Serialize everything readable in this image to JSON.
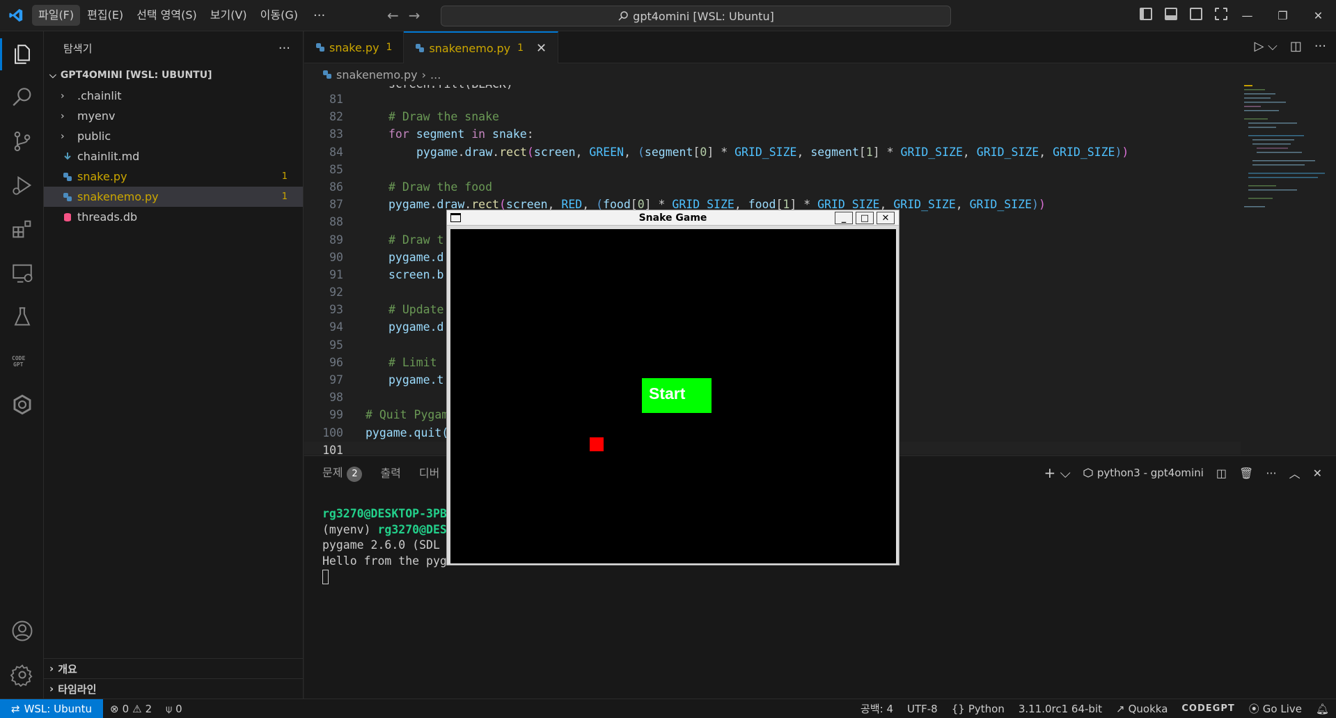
{
  "titlebar": {
    "menu": [
      "파일(F)",
      "편집(E)",
      "선택 영역(S)",
      "보기(V)",
      "이동(G)"
    ],
    "more": "···",
    "search": "gpt4omini [WSL: Ubuntu]"
  },
  "sidebar": {
    "title": "탐색기",
    "more": "···",
    "workspace": "GPT4OMINI [WSL: UBUNTU]",
    "items": [
      {
        "name": ".chainlit",
        "type": "folder"
      },
      {
        "name": "myenv",
        "type": "folder"
      },
      {
        "name": "public",
        "type": "folder"
      },
      {
        "name": "chainlit.md",
        "type": "markdown"
      },
      {
        "name": "snake.py",
        "type": "python",
        "badge": "1"
      },
      {
        "name": "snakenemo.py",
        "type": "python",
        "badge": "1",
        "selected": true
      },
      {
        "name": "threads.db",
        "type": "database"
      }
    ],
    "outline": "개요",
    "timeline": "타임라인"
  },
  "tabs": [
    {
      "label": "snake.py",
      "count": "1"
    },
    {
      "label": "snakenemo.py",
      "count": "1",
      "close": "✕"
    }
  ],
  "breadcrumb": {
    "file": "snakenemo.py",
    "sep": "...",
    "arrow": "›"
  },
  "code": {
    "top_partial": "screen.fill(BLACK)",
    "ln81": "81",
    "ln82": "82",
    "ln83": "83",
    "ln84": "84",
    "ln85": "85",
    "ln86": "86",
    "ln87": "87",
    "ln88": "88",
    "ln89": "89",
    "ln90": "90",
    "ln91": "91",
    "ln92": "92",
    "ln93": "93",
    "ln94": "94",
    "ln95": "95",
    "ln96": "96",
    "ln97": "97",
    "ln98": "98",
    "ln99": "99",
    "ln100": "100",
    "ln101": "101",
    "c82": "# Draw the snake",
    "c86": "# Draw the food",
    "c89": "# Draw t",
    "c93": "# Update",
    "c96": "# Limit",
    "c99": "# Quit Pygam",
    "l90": "pygame.d",
    "l91": "screen.b",
    "l94": "pygame.d",
    "l97": "pygame.t",
    "l100": "pygame.quit("
  },
  "panel": {
    "tab_problems": "문제",
    "problems_count": "2",
    "tab_output": "출력",
    "tab_debug": "디버",
    "terminal_name": "python3 - gpt4omini",
    "lines": [
      "rg3270@DESKTOP-3PB",
      "rg3270@DES",
      "pygame 2.6.0 (SDL",
      "Hello from the pyg"
    ],
    "myenv_prefix": "(myenv) "
  },
  "statusbar": {
    "remote": "WSL: Ubuntu",
    "errors": "0",
    "warnings": "2",
    "ports": "0",
    "spaces": "공백: 4",
    "encoding": "UTF-8",
    "language": "Python",
    "interpreter": "3.11.0rc1 64-bit",
    "quokka": "Quokka",
    "codegpt": "CODEGPT",
    "golive": "Go Live"
  },
  "game": {
    "title": "Snake Game",
    "start_label": "Start",
    "colors": {
      "button": "#00ff00",
      "food": "#ff0000",
      "background": "#000000"
    }
  }
}
